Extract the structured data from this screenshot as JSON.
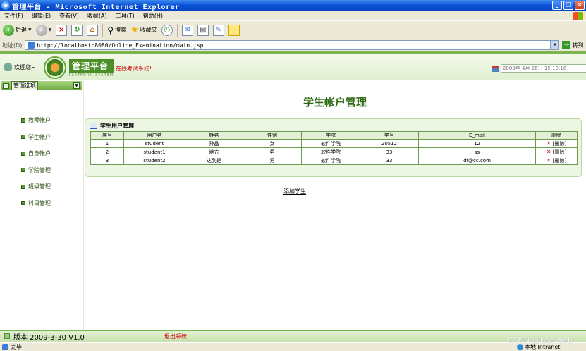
{
  "window": {
    "title": "管理平台 - Microsoft Internet Explorer",
    "controls": {
      "minimize": "_",
      "maximize": "□",
      "close": "×"
    }
  },
  "menubar": [
    "文件(F)",
    "编辑(E)",
    "查看(V)",
    "收藏(A)",
    "工具(T)",
    "帮助(H)"
  ],
  "toolbar": {
    "back_label": "后退",
    "search_label": "搜索",
    "favorites_label": "收藏夹"
  },
  "address": {
    "label": "地址(D)",
    "url": "http://localhost:8080/Online_Examination/main.jsp",
    "go_label": "转到"
  },
  "header": {
    "welcome": "欢迎您~",
    "brand_cn": "管理平台",
    "brand_en": "PLATFORM SYSTEM",
    "system_name": "在线考试系统!",
    "datetime": "2009年 4月 26日 15:10:16"
  },
  "sidebar": {
    "title": "管理选项",
    "items": [
      "教师帐户",
      "学生帐户",
      "自身帐户",
      "学院管理",
      "班级管理",
      "科目管理"
    ]
  },
  "main": {
    "page_title": "学生帐户管理",
    "panel_title": "学生用户管理",
    "columns": [
      "序号",
      "用户名",
      "姓名",
      "性别",
      "学院",
      "学号",
      "E_mail",
      "删除"
    ],
    "rows": [
      {
        "no": "1",
        "username": "student",
        "name": "孙晶",
        "gender": "女",
        "college": "软件学院",
        "student_id": "20512",
        "email": "12",
        "delete": "[删除]"
      },
      {
        "no": "2",
        "username": "student1",
        "name": "地方",
        "gender": "男",
        "college": "软件学院",
        "student_id": "33",
        "email": "ss",
        "delete": "[删除]"
      },
      {
        "no": "3",
        "username": "student2",
        "name": "达到是",
        "gender": "男",
        "college": "软件学院",
        "student_id": "33",
        "email": "df@cc.com",
        "delete": "[删除]"
      }
    ],
    "add_link": "添加学生"
  },
  "footer": {
    "version": "版本 2009-3-30 V1.0",
    "logout": "退出系统"
  },
  "statusbar": {
    "status": "完毕",
    "zone": "本地 Intranet"
  },
  "watermark": "CSDN @Lee-web",
  "colors": {
    "accent_green": "#4b8f26",
    "titlebar_blue": "#0a53d6",
    "alert_red": "#cc0000"
  }
}
